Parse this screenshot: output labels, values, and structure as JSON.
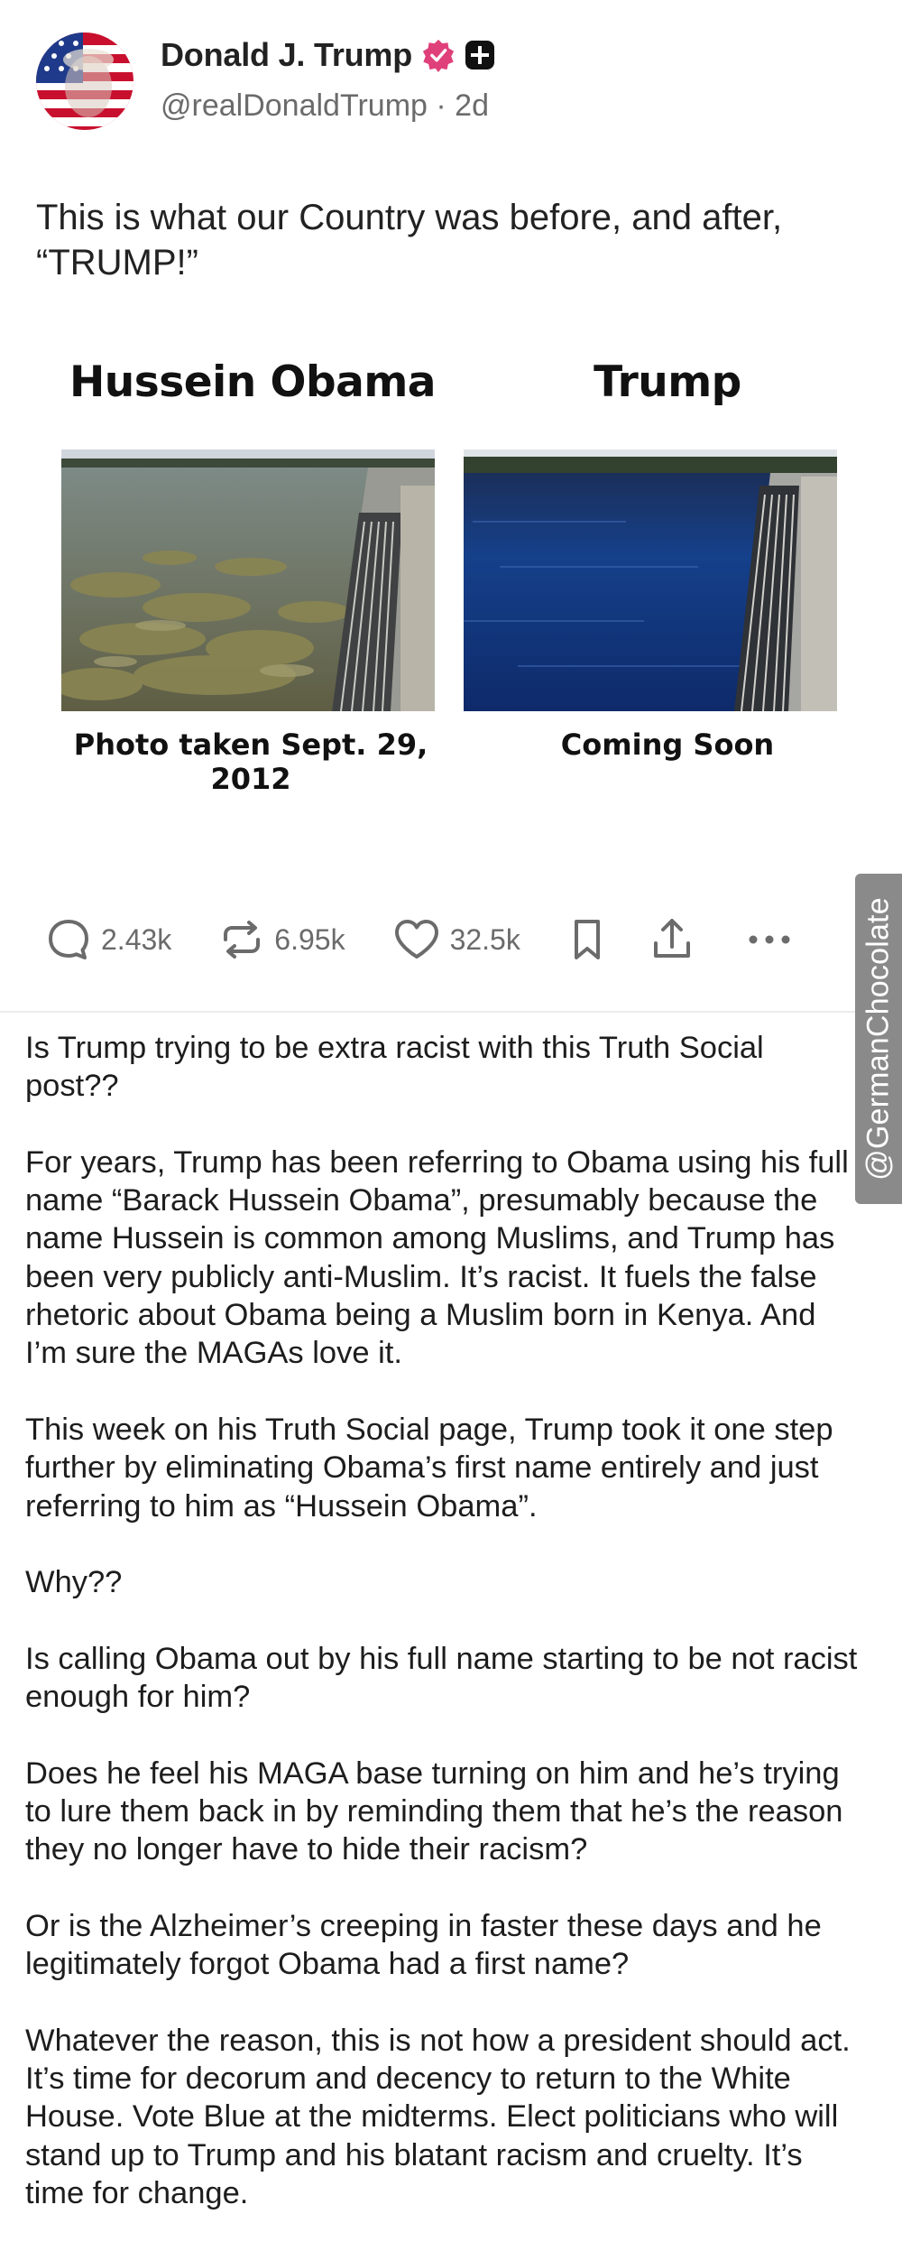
{
  "header": {
    "display_name": "Donald J. Trump",
    "handle": "@realDonaldTrump",
    "separator": "·",
    "time_ago": "2d"
  },
  "post": {
    "text": "This is what our Country was before, and after, “TRUMP!”"
  },
  "image_card": {
    "left_title": "Hussein Obama",
    "right_title": "Trump",
    "left_caption": "Photo taken Sept. 29, 2012",
    "right_caption": "Coming Soon"
  },
  "actions": {
    "replies": "2.43k",
    "retruths": "6.95k",
    "likes": "32.5k"
  },
  "watermark": "@GermanChocolate",
  "commentary": {
    "p1": "Is Trump trying to be extra racist with this Truth Social post??",
    "p2": "For years, Trump has been referring to Obama using his full name “Barack Hussein Obama”, presumably because the name Hussein is common among Muslims, and Trump has been very publicly anti-Muslim. It’s racist. It fuels the false rhetoric about Obama being a Muslim born in Kenya. And I’m sure the MAGAs love it.",
    "p3": "This week on his Truth Social page, Trump took it one step further by eliminating Obama’s first name entirely and just referring to him as “Hussein Obama”.",
    "p4": "Why??",
    "p5": "Is calling Obama out by his full name starting to be not racist enough for him?",
    "p6": "Does he feel his MAGA base turning on him and he’s trying to lure them back in by reminding them that he’s the reason they no longer have to hide their racism?",
    "p7": "Or is the Alzheimer’s creeping in faster these days and he legitimately forgot Obama had a first name?",
    "p8": "Whatever the reason, this is not how a president should act. It’s time for decorum and decency to return to the White House. Vote Blue at the midterms. Elect politicians who will stand up to Trump and his blatant racism and cruelty. It’s time for change."
  },
  "colors": {
    "verified_badge": "#e0407a",
    "muted_text": "#6b6b6b",
    "watermark_bg": "#8a8a8a"
  }
}
